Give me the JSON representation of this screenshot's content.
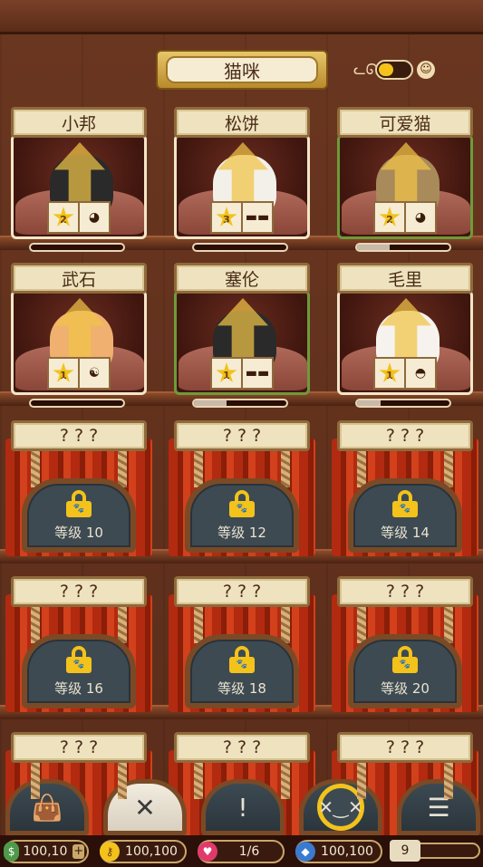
{
  "header": {
    "title": "猫咪"
  },
  "cats": [
    {
      "name": "小邦",
      "stars": 2,
      "trait_icon": "sleepy-face-icon",
      "progress": 0,
      "green": false,
      "color": "#2a2a2a"
    },
    {
      "name": "松饼",
      "stars": 3,
      "trait_icon": "sunglasses-icon",
      "progress": 0,
      "green": false,
      "color": "#f3f0ea"
    },
    {
      "name": "可爱猫",
      "stars": 2,
      "trait_icon": "sleepy-face-icon",
      "progress": 0.35,
      "green": true,
      "color": "#a98a5a"
    },
    {
      "name": "武石",
      "stars": 1,
      "trait_icon": "yin-yang-icon",
      "progress": 0,
      "green": false,
      "color": "#f0b070"
    },
    {
      "name": "塞伦",
      "stars": 1,
      "trait_icon": "sunglasses-icon",
      "progress": 0.35,
      "green": true,
      "color": "#2a2a2a"
    },
    {
      "name": "毛里",
      "stars": 1,
      "trait_icon": "bowl-icon",
      "progress": 0.25,
      "green": false,
      "color": "#f6f3ee"
    }
  ],
  "locked_slots": [
    {
      "name": "? ? ?",
      "level_label": "等级 10"
    },
    {
      "name": "? ? ?",
      "level_label": "等级 12"
    },
    {
      "name": "? ? ?",
      "level_label": "等级 14"
    },
    {
      "name": "? ? ?",
      "level_label": "等级 16"
    },
    {
      "name": "? ? ?",
      "level_label": "等级 18"
    },
    {
      "name": "? ? ?",
      "level_label": "等级 20"
    },
    {
      "name": "? ? ?"
    },
    {
      "name": "? ? ?"
    },
    {
      "name": "? ? ?"
    }
  ],
  "toolbar": [
    {
      "icon": "shopping-bag-icon",
      "glyph": "👜"
    },
    {
      "icon": "close-icon",
      "glyph": "✕"
    },
    {
      "icon": "alert-bowl-icon",
      "glyph": "!"
    },
    {
      "icon": "cat-sofa-icon",
      "glyph": "✕‿✕"
    },
    {
      "icon": "checklist-icon",
      "glyph": "☰"
    }
  ],
  "status": {
    "cash": "100,10",
    "keys": "100,100",
    "hearts": "1/6",
    "gems": "100,100",
    "level": "9"
  },
  "colors": {
    "star": "#f1c21b",
    "gold": "#f3c21b",
    "wood": "#5a2d1a"
  }
}
